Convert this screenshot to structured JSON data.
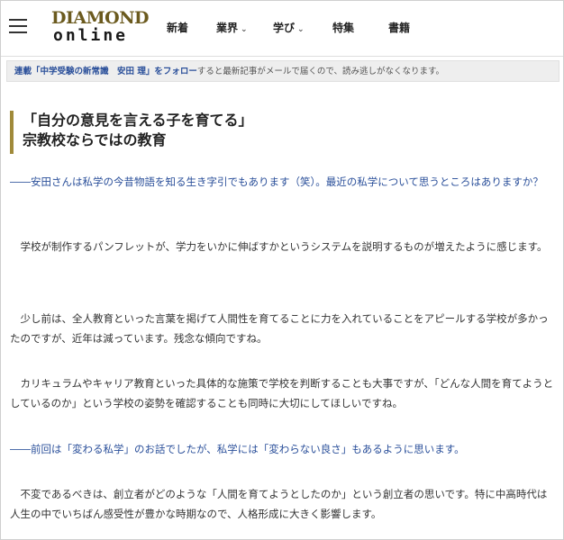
{
  "header": {
    "logo": {
      "top": "DIAMOND",
      "bottom": "online"
    },
    "nav": [
      {
        "label": "新着",
        "has_dropdown": false
      },
      {
        "label": "業界",
        "has_dropdown": true
      },
      {
        "label": "学び",
        "has_dropdown": true
      },
      {
        "label": "特集",
        "has_dropdown": false
      },
      {
        "label": "書籍",
        "has_dropdown": false
      }
    ],
    "chevron": "⌄"
  },
  "banner": {
    "prefix": "連載「",
    "series_title": "中学受験の新常識　安田 理",
    "follow_label": "」をフォロー",
    "suffix": "すると最新記事がメールで届くので、読み逃しがなくなります。"
  },
  "article": {
    "heading": [
      "「自分の意見を言える子を育てる」",
      "宗教校ならではの教育"
    ],
    "paragraphs": [
      {
        "type": "question",
        "text": "――安田さんは私学の今昔物語を知る生き字引でもあります（笑）。最近の私学について思うところはありますか？"
      },
      {
        "type": "answer",
        "text": "　学校が制作するパンフレットが、学力をいかに伸ばすかというシステムを説明するものが増えたように感じます。"
      },
      {
        "type": "answer",
        "text": "　少し前は、全人教育といった言葉を掲げて人間性を育てることに力を入れていることをアピールする学校が多かったのですが、近年は減っています。残念な傾向ですね。"
      },
      {
        "type": "answer",
        "text": "　カリキュラムやキャリア教育といった具体的な施策で学校を判断することも大事ですが、「どんな人間を育てようとしているのか」という学校の姿勢を確認することも同時に大切にしてほしいですね。"
      },
      {
        "type": "question",
        "text": "――前回は「変わる私学」のお話でしたが、私学には「変わらない良さ」もあるように思います。"
      },
      {
        "type": "answer",
        "text": "　不変であるべきは、創立者がどのような「人間を育てようとしたのか」という創立者の思いです。特に中高時代は人生の中でいちばん感受性が豊かな時期なので、人格形成に大きく影響します。"
      }
    ]
  }
}
